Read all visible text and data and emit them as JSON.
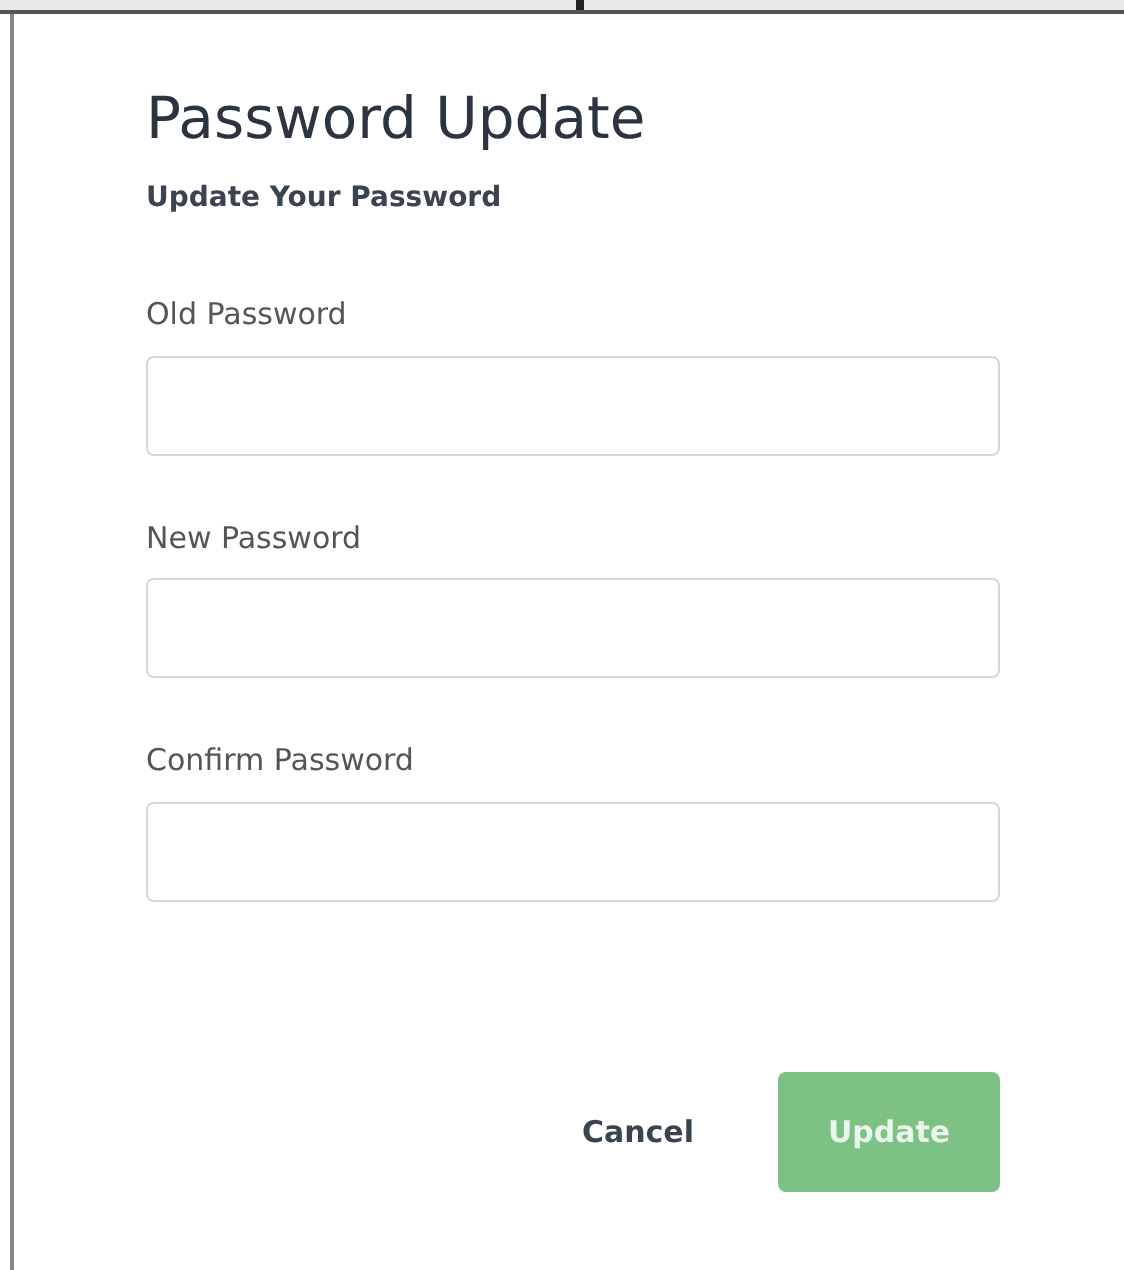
{
  "dialog": {
    "title": "Password Update",
    "subtitle": "Update Your Password"
  },
  "fields": [
    {
      "label": "Old Password"
    },
    {
      "label": "New Password"
    },
    {
      "label": "Confirm Password"
    }
  ],
  "buttons": {
    "cancel": {
      "label": "Cancel"
    },
    "update": {
      "label": "Update",
      "disabled": true
    }
  }
}
